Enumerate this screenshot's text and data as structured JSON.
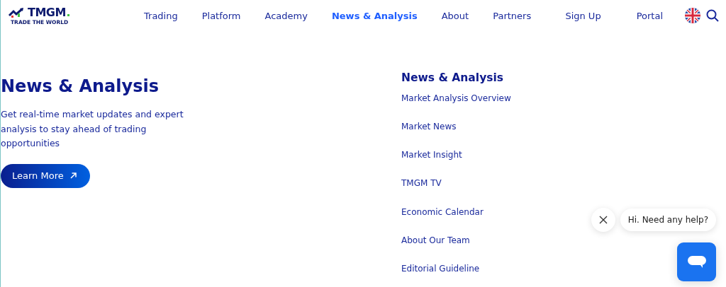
{
  "logo": {
    "name": "TMGM",
    "tagline": "TRADE THE WORLD"
  },
  "nav": [
    {
      "label": "Trading",
      "selected": false
    },
    {
      "label": "Platform",
      "selected": false
    },
    {
      "label": "Academy",
      "selected": false
    },
    {
      "label": "News & Analysis",
      "selected": true
    },
    {
      "label": "About",
      "selected": false
    },
    {
      "label": "Partners",
      "selected": false
    }
  ],
  "header_actions": [
    "Sign Up",
    "Portal"
  ],
  "hero": {
    "title": "News & Analysis",
    "description": "Get real-time market updates and expert analysis to stay ahead of trading opportunities",
    "button": "Learn More"
  },
  "submenu": {
    "title": "News & Analysis",
    "items": [
      "Market Analysis Overview",
      "Market News",
      "Market Insight",
      "TMGM TV",
      "Economic Calendar",
      "About Our Team",
      "Editorial Guideline"
    ]
  },
  "chat": {
    "greeting": "Hi. Need any help?"
  }
}
